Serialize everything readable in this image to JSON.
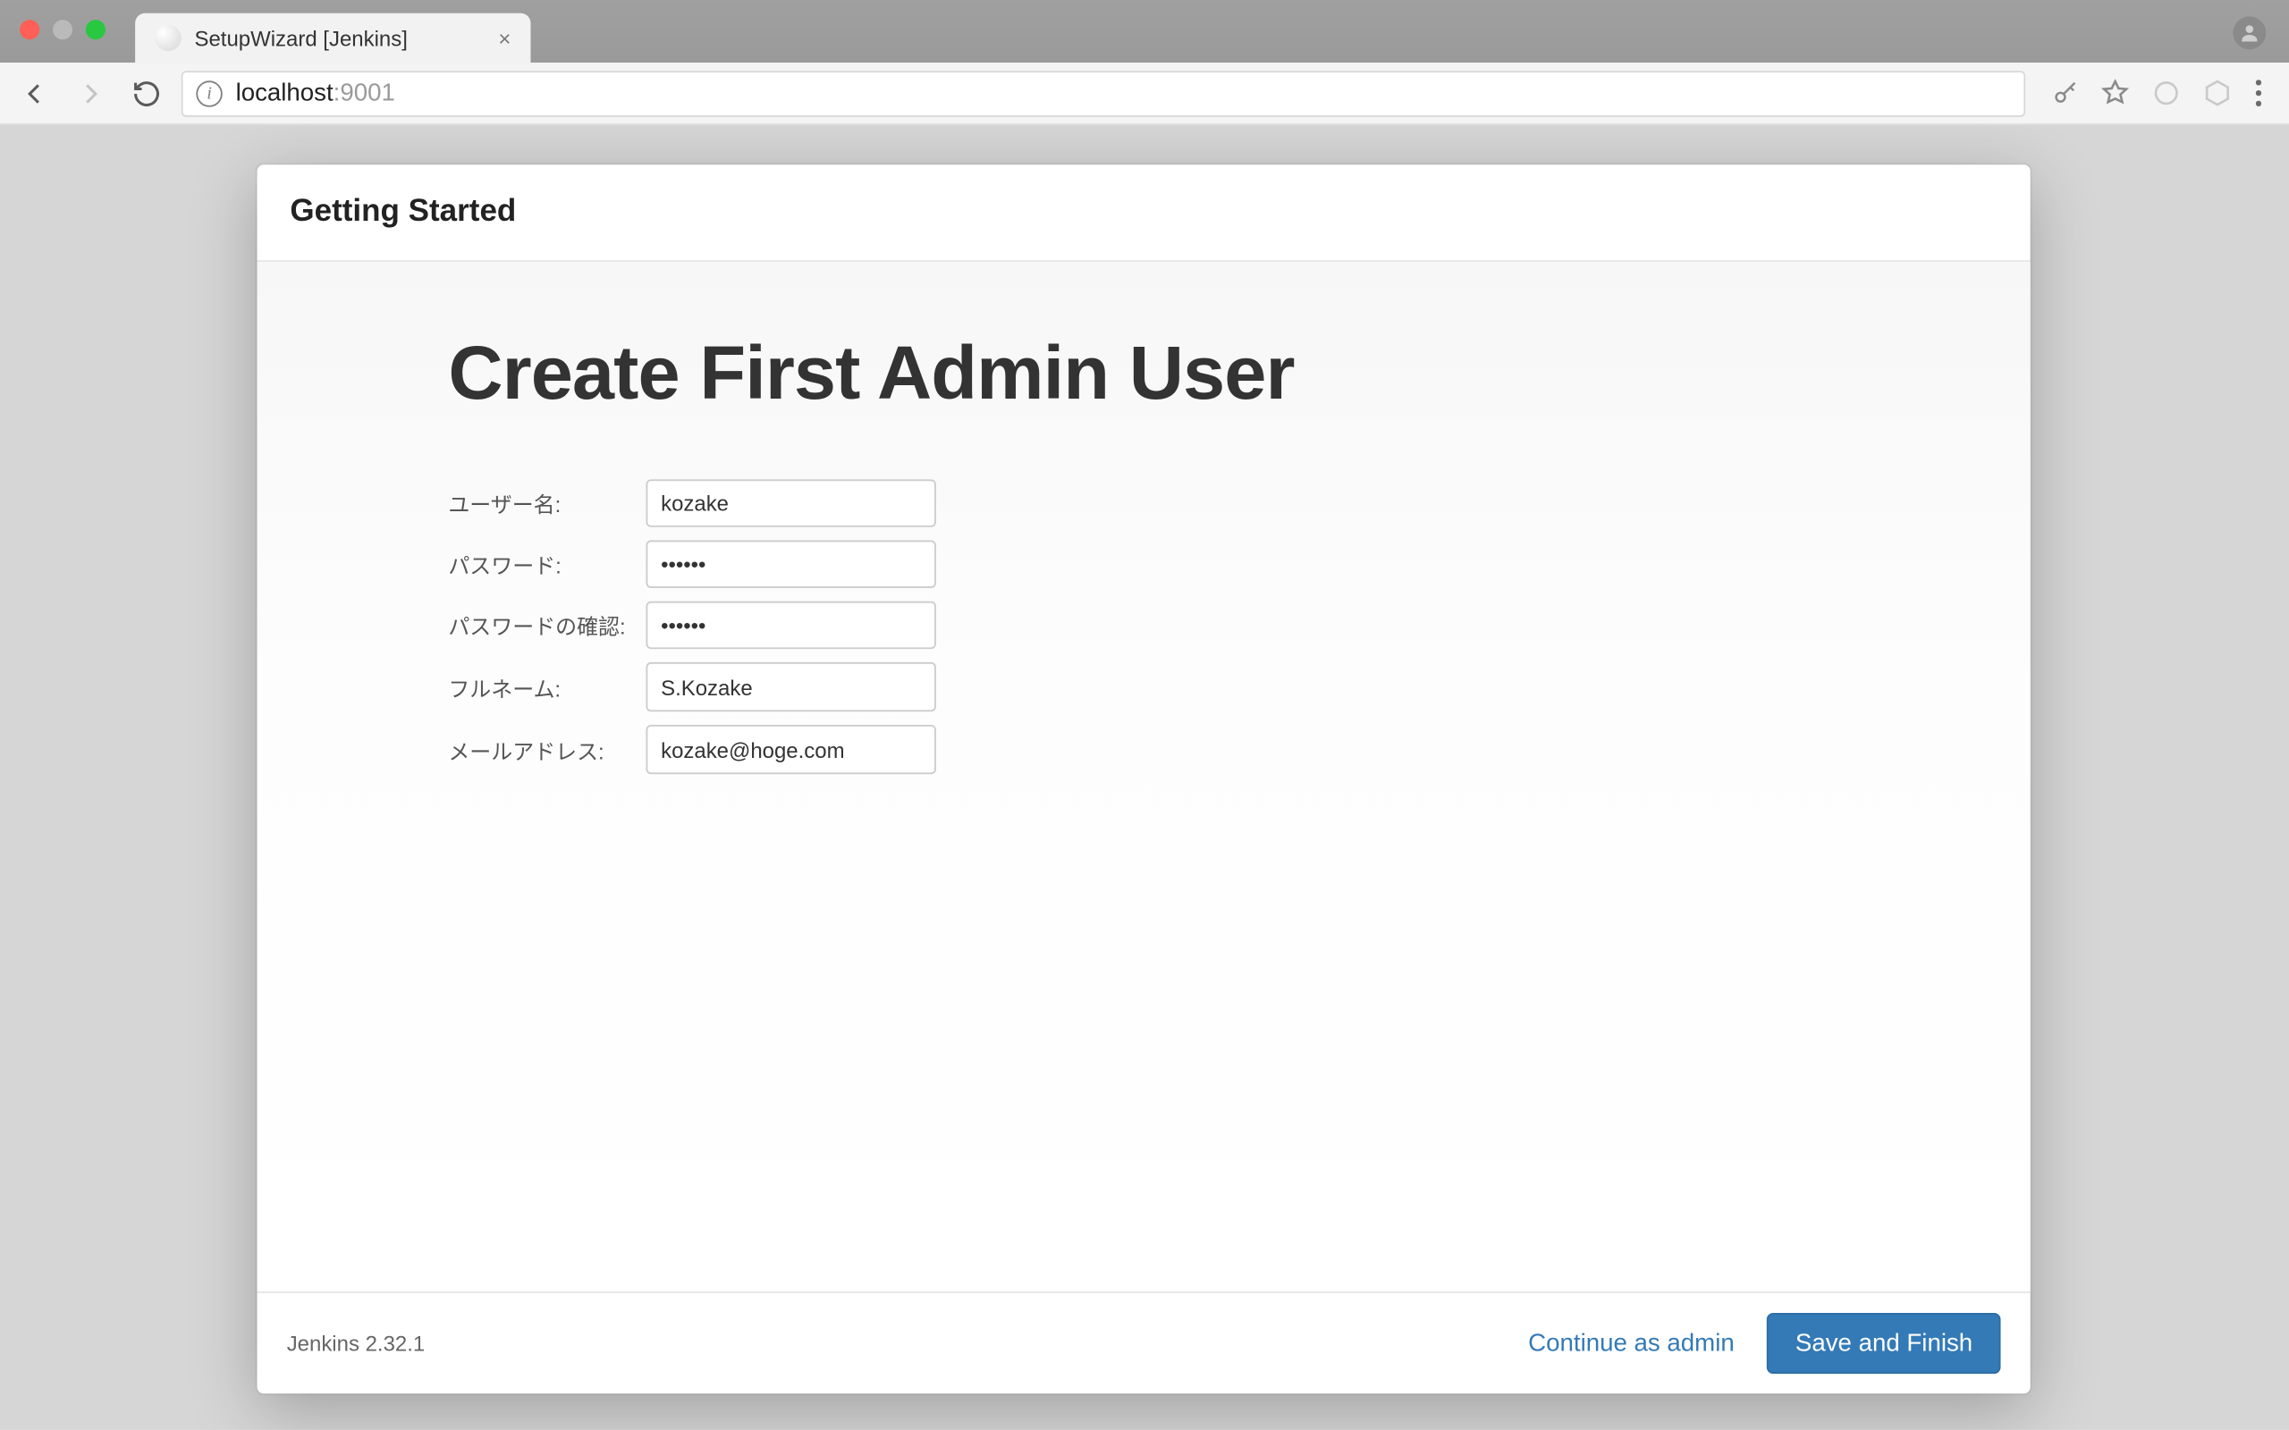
{
  "browser": {
    "tab_title": "SetupWizard [Jenkins]",
    "url_host": "localhost",
    "url_port": ":9001"
  },
  "dialog": {
    "header": "Getting Started",
    "title": "Create First Admin User",
    "version": "Jenkins 2.32.1",
    "continue_label": "Continue as admin",
    "save_label": "Save and Finish"
  },
  "form": {
    "username_label": "ユーザー名:",
    "username_value": "kozake",
    "password_label": "パスワード:",
    "password_value": "••••••",
    "confirm_label": "パスワードの確認:",
    "confirm_value": "••••••",
    "fullname_label": "フルネーム:",
    "fullname_value": "S.Kozake",
    "email_label": "メールアドレス:",
    "email_value": "kozake@hoge.com"
  }
}
